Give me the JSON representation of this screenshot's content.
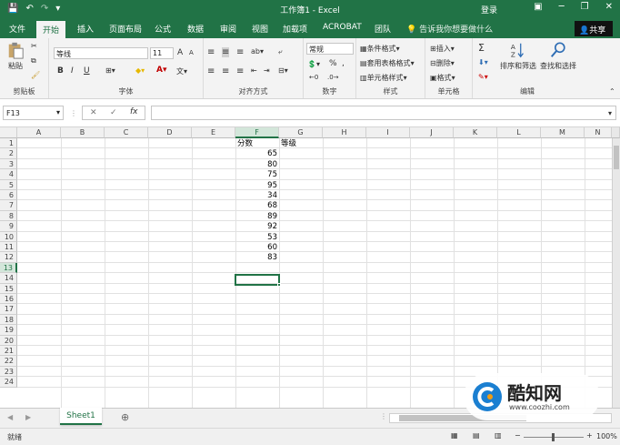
{
  "titlebar": {
    "title": "工作簿1 - Excel",
    "login": "登录",
    "qat_save": "💾",
    "qat_undo": "↶",
    "qat_redo": "↷",
    "win_min": "─",
    "win_restore": "❐",
    "win_close": "✕",
    "ribbon_opts": "▣"
  },
  "tabs": [
    "文件",
    "开始",
    "插入",
    "页面布局",
    "公式",
    "数据",
    "审阅",
    "视图",
    "加载项",
    "ACROBAT",
    "团队"
  ],
  "active_tab": "开始",
  "tellme": "告诉我你想要做什么",
  "share": "共享",
  "ribbon": {
    "clipboard": {
      "label": "剪贴板",
      "paste": "粘贴"
    },
    "font": {
      "label": "字体",
      "font_name": "等线",
      "font_size": "11",
      "bold": "B",
      "italic": "I",
      "underline": "U",
      "grow": "A",
      "shrink": "A"
    },
    "alignment": {
      "label": "对齐方式"
    },
    "number": {
      "label": "数字",
      "format": "常规",
      "percent": "%",
      "comma": ","
    },
    "styles": {
      "label": "样式",
      "conditional": "条件格式",
      "table": "套用表格格式",
      "cell": "单元格样式"
    },
    "cells": {
      "label": "单元格",
      "insert": "插入",
      "delete": "删除",
      "format": "格式"
    },
    "editing": {
      "label": "编辑",
      "sum": "Σ",
      "sort": "排序和筛选",
      "find": "查找和选择"
    }
  },
  "formula": {
    "namebox": "F13",
    "cancel": "✕",
    "enter": "✓",
    "fx": "fx",
    "value": ""
  },
  "columns": [
    "A",
    "B",
    "C",
    "D",
    "E",
    "F",
    "G",
    "H",
    "I",
    "J",
    "K",
    "L",
    "M",
    "N"
  ],
  "selected_column": "F",
  "rows": [
    "1",
    "2",
    "3",
    "4",
    "5",
    "6",
    "7",
    "8",
    "9",
    "10",
    "11",
    "12",
    "13",
    "14",
    "15",
    "16",
    "17",
    "18",
    "19",
    "20",
    "21",
    "22",
    "23",
    "24"
  ],
  "selected_row": "13",
  "cells": {
    "F1": "分数",
    "G1": "等级",
    "F_values": [
      "65",
      "80",
      "75",
      "95",
      "34",
      "68",
      "89",
      "92",
      "53",
      "60",
      "83"
    ]
  },
  "sheet_tab": "Sheet1",
  "add_sheet": "⊕",
  "status": {
    "ready": "就绪",
    "zoom": "100%"
  },
  "watermark": {
    "brand": "酷知网",
    "url": "www.coozhi.com"
  },
  "colors": {
    "accent": "#217346",
    "tab_bg": "#f3f3f3",
    "grid": "#e1e1e1"
  }
}
